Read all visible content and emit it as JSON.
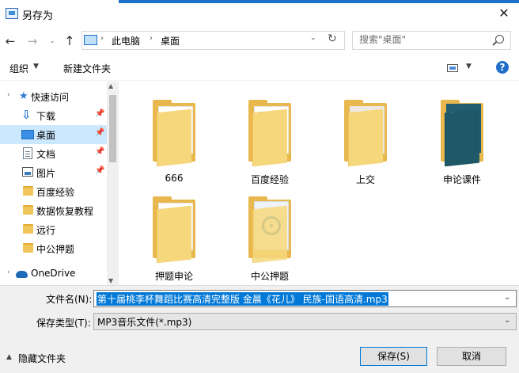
{
  "window": {
    "title": "另存为",
    "close_glyph": "✕"
  },
  "nav": {
    "back_glyph": "←",
    "forward_glyph": "→",
    "recent_glyph": "⌄",
    "up_glyph": "↑",
    "breadcrumb": [
      "此电脑",
      "桌面"
    ],
    "sep_glyph": "›",
    "dropdown_glyph": "⌄",
    "refresh_glyph": "↻",
    "search_placeholder": "搜索\"桌面\""
  },
  "toolbar": {
    "organize_label": "组织",
    "chevron": "▼",
    "new_folder_label": "新建文件夹",
    "help_glyph": "?"
  },
  "sidebar": {
    "chevron": "›",
    "quick_access": "快速访问",
    "items": [
      {
        "label": "下载",
        "icon": "download-icon",
        "pinned": true
      },
      {
        "label": "桌面",
        "icon": "desktop-icon",
        "pinned": true
      },
      {
        "label": "文档",
        "icon": "document-icon",
        "pinned": true
      },
      {
        "label": "图片",
        "icon": "picture-icon",
        "pinned": true
      },
      {
        "label": "百度经验",
        "icon": "folder-icon"
      },
      {
        "label": "数据恢复教程",
        "icon": "folder-icon"
      },
      {
        "label": "远行",
        "icon": "folder-icon"
      },
      {
        "label": "中公押题",
        "icon": "folder-icon"
      }
    ],
    "onedrive": "OneDrive",
    "pin_glyph": "📌"
  },
  "files": [
    {
      "name": "666"
    },
    {
      "name": "百度经验"
    },
    {
      "name": "上交"
    },
    {
      "name": "申论课件"
    },
    {
      "name": "押题申论"
    },
    {
      "name": "中公押题"
    }
  ],
  "form": {
    "filename_label": "文件名(N):",
    "filename_value": "第十届桃李杯舞蹈比赛高清完整版 金晨《花儿》 民族-国语高清.mp3",
    "filetype_label": "保存类型(T):",
    "filetype_value": "MP3音乐文件(*.mp3)",
    "dropdown_glyph": "⌄"
  },
  "footer": {
    "hide_folders_label": "隐藏文件夹",
    "hide_chevron": "▲",
    "save_label": "保存(S)",
    "cancel_label": "取消"
  },
  "colors": {
    "accent": "#0078d7",
    "selected_bg": "#cce8ff",
    "folder": "#f0c65a"
  }
}
